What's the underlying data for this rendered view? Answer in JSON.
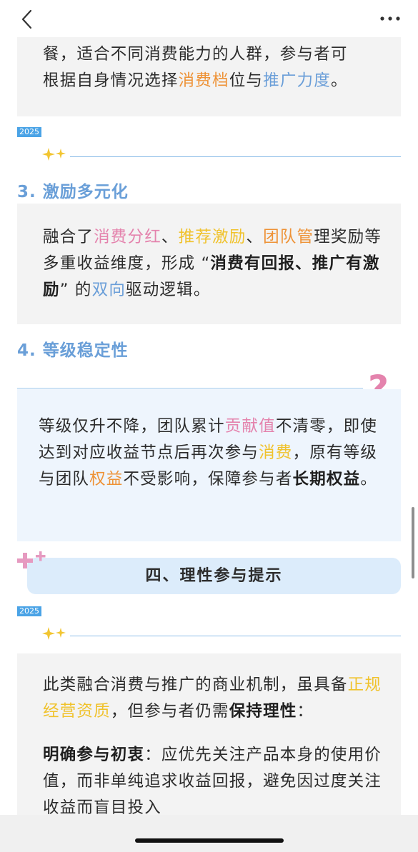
{
  "icons": {
    "back": "chevron-left-icon",
    "more": "ellipsis-icon"
  },
  "colors": {
    "pink": "#e483ad",
    "orange": "#ee9236",
    "blue": "#6a9ed8",
    "yellow": "#f0c22c",
    "section_blue": "#6a9fd8"
  },
  "card1": {
    "line1": "餐，适合不同消费能力的人群，参与者可",
    "line2_a": "根据自身情况选择",
    "line2_hl1": "消费档",
    "line2_b": "位与",
    "line2_hl2": "推广力度",
    "line2_c": "。"
  },
  "year_tag": "2025",
  "section3": {
    "title": "3. 激励多元化",
    "p_a": "融合了",
    "hl1": "消费分红",
    "p_b": "、",
    "hl2": "推荐激励",
    "p_c": "、",
    "hl3": "团队管",
    "p_d": "理奖励等多重收益维度，形成 “",
    "bold": "消费有回报、推广有激励",
    "p_e": "” 的",
    "hl4": "双向",
    "p_f": "驱动逻辑。"
  },
  "section4": {
    "title": "4. 等级稳定性",
    "q_mark": "?",
    "p_a": "等级仅升不降，团队累计",
    "hl1": "贡献值",
    "p_b": "不清零，即使达到对应收益节点后再次参与",
    "hl2": "消费",
    "p_c": "，原有等级与团队",
    "hl3": "权益",
    "p_d": "不受影响，保障参与者",
    "bold": "长期权益",
    "p_e": "。"
  },
  "heading4": "四、理性参与提示",
  "section5": {
    "p1_a": "此类融合消费与推广的商业机制，虽具备",
    "p1_hl": "正规经营资质",
    "p1_b": "，但参与者仍需",
    "p1_bold": "保持理性",
    "p1_c": "：",
    "p2_bold": "明确参与初衷",
    "p2_a": "：应优先关注产品本身的使用价值，而非单纯追求收益回报，避免因",
    "p2_cut": "过度关注收益而盲目投入"
  }
}
